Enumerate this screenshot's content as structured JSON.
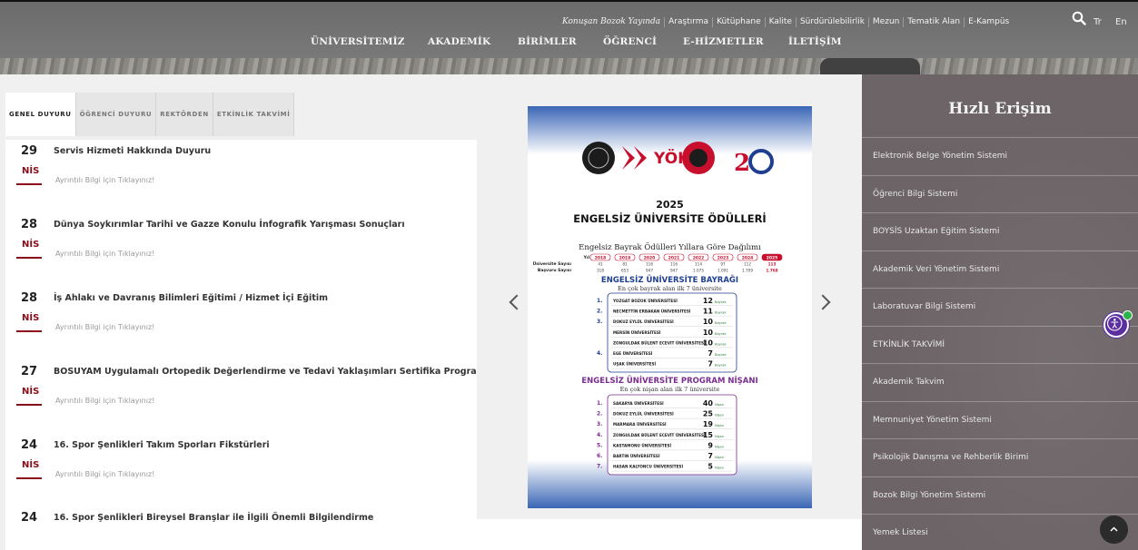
{
  "header": {
    "top_links": [
      "Konuşan Bozok Yayında",
      "Araştırma",
      "Kütüphane",
      "Kalite",
      "Sürdürülebilirlik",
      "Mezun",
      "Tematik Alan",
      "E-Kampüs"
    ],
    "lang_tr": "Tr",
    "lang_en": "En",
    "nav": [
      "ÜNİVERSİTEMİZ",
      "AKADEMİK",
      "BİRİMLER",
      "ÖĞRENCİ",
      "E-HİZMETLER",
      "İLETİŞİM"
    ]
  },
  "announcements": {
    "tabs": [
      "GENEL DUYURU",
      "ÖĞRENCİ DUYURU",
      "REKTÖRDEN",
      "ETKİNLİK TAKVİMİ"
    ],
    "active_tab": "GENEL DUYURU",
    "more_label": "Ayrıntılı Bilgi için Tıklayınız!",
    "items": [
      {
        "day": "29",
        "month": "NİS",
        "title": "Servis Hizmeti Hakkında Duyuru"
      },
      {
        "day": "28",
        "month": "NİS",
        "title": "Dünya Soykırımlar Tarihi ve Gazze Konulu İnfografik Yarışması Sonuçları"
      },
      {
        "day": "28",
        "month": "NİS",
        "title": "İş Ahlakı ve Davranış Bilimleri Eğitimi / Hizmet İçi Eğitim"
      },
      {
        "day": "27",
        "month": "NİS",
        "title": "BOSUYAM Uygulamalı Ortopedik Değerlendirme ve Tedavi Yaklaşımları Sertifika Programı"
      },
      {
        "day": "24",
        "month": "NİS",
        "title": "16. Spor Şenlikleri Takım Sporları Fikstürleri"
      },
      {
        "day": "24",
        "month": "",
        "title": "16. Spor Şenlikleri Bireysel Branşlar ile İlgili Önemli Bilgilendirme"
      }
    ]
  },
  "poster": {
    "logo_text": "YÖK",
    "year": "2025",
    "title": "ENGELSİZ ÜNİVERSİTE ÖDÜLLERİ",
    "table_title": "Engelsiz Bayrak Ödülleri Yıllara Göre Dağılımı",
    "row_year_label": "Yıl",
    "row_uni_label": "Üniversite Sayısı",
    "row_app_label": "Başvuru Sayısı",
    "years": [
      "2018",
      "2019",
      "2020",
      "2021",
      "2022",
      "2023",
      "2024",
      "2025"
    ],
    "uni_counts": [
      "41",
      "81",
      "116",
      "116",
      "114",
      "97",
      "112",
      "113"
    ],
    "app_counts": [
      "318",
      "653",
      "947",
      "947",
      "1.075",
      "1.091",
      "1.709",
      "1.768"
    ],
    "flag_title": "ENGELSİZ ÜNİVERSİTE BAYRAĞI",
    "flag_subtitle": "En çok bayrak alan ilk 7 üniversite",
    "flag_ranks": [
      {
        "rank": "1.",
        "name": "YOZGAT BOZOK ÜNİVERSİTESİ",
        "count": "12"
      },
      {
        "rank": "2.",
        "name": "NECMETTİN ERBAKAN ÜNİVERSİTESİ",
        "count": "11"
      },
      {
        "rank": "3.",
        "name": "DOKUZ EYLÜL ÜNİVERSİTESİ",
        "count": "10"
      },
      {
        "rank": "",
        "name": "MERSİN ÜNİVERSİTESİ",
        "count": "10"
      },
      {
        "rank": "",
        "name": "ZONGULDAK BÜLENT ECEVİT ÜNİVERSİTESİ",
        "count": "10"
      },
      {
        "rank": "4.",
        "name": "EGE ÜNİVERSİTESİ",
        "count": "7"
      },
      {
        "rank": "",
        "name": "UŞAK ÜNİVERSİTESİ",
        "count": "7"
      }
    ],
    "flag_unit": "Bayrak",
    "program_title": "ENGELSİZ ÜNİVERSİTE PROGRAM NİŞANI",
    "program_subtitle": "En çok nişan alan ilk 7 üniversite",
    "program_ranks": [
      {
        "rank": "1.",
        "name": "SAKARYA ÜNİVERSİTESİ",
        "count": "40"
      },
      {
        "rank": "2.",
        "name": "DOKUZ EYLÜL ÜNİVERSİTESİ",
        "count": "25"
      },
      {
        "rank": "3.",
        "name": "MARMARA ÜNİVERSİTESİ",
        "count": "19"
      },
      {
        "rank": "4.",
        "name": "ZONGULDAK BÜLENT ECEVİT ÜNİVERSİTESİ",
        "count": "15"
      },
      {
        "rank": "5.",
        "name": "KASTAMONU ÜNİVERSİTESİ",
        "count": "9"
      },
      {
        "rank": "6.",
        "name": "BARTIN ÜNİVERSİTESİ",
        "count": "7"
      },
      {
        "rank": "7.",
        "name": "HASAN KALYONCU ÜNİVERSİTESİ",
        "count": "5"
      }
    ],
    "program_unit": "Nişan"
  },
  "quick_access": {
    "heading": "Hızlı Erişim",
    "items": [
      "Elektronik Belge Yönetim Sistemi",
      "Öğrenci Bilgi Sistemi",
      "BOYSİS Uzaktan Eğitim Sistemi",
      "Akademik Veri Yönetim Sistemi",
      "Laboratuvar Bilgi Sistemi",
      "ETKİNLİK TAKVİMİ",
      "Akademik Takvim",
      "Memnuniyet Yönetim Sistemi",
      "Psikolojik Danışma ve Rehberlik Birimi",
      "Bozok Bilgi Yönetim Sistemi",
      "Yemek Listesi"
    ]
  },
  "colors": {
    "brand_red": "#8b0d1a",
    "poster_blue": "#1e3f8f",
    "poster_purple": "#7a2d8f",
    "poster_red": "#c8102e",
    "quick_bg": "#6c6466"
  }
}
